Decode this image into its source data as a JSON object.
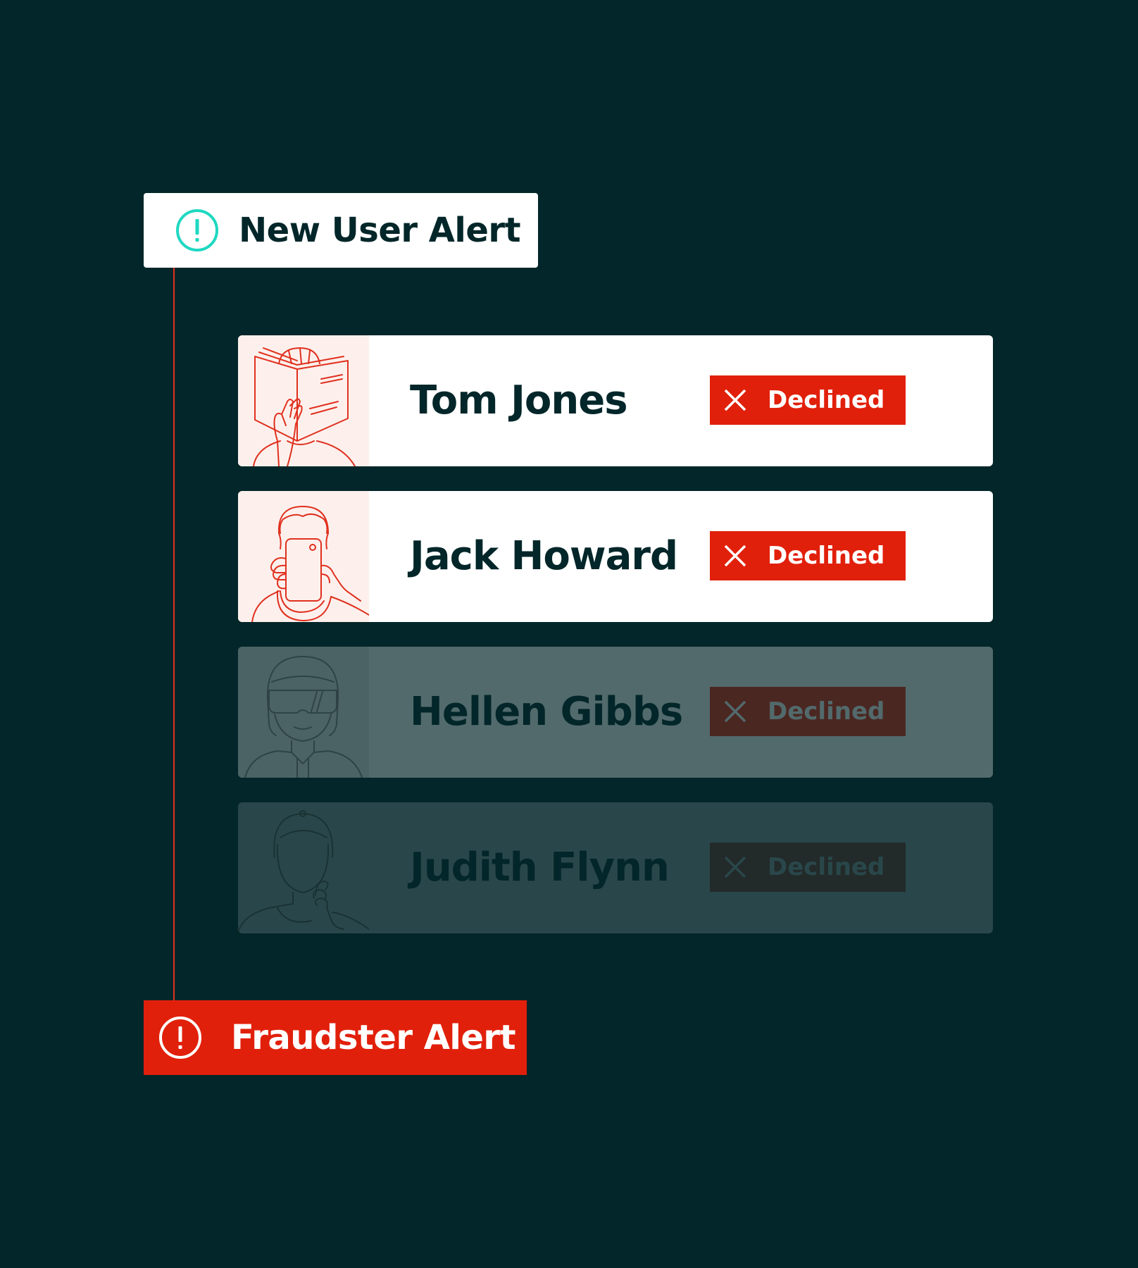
{
  "colors": {
    "background": "#022629",
    "accent_red": "#e1200b",
    "accent_teal": "#1fd8c1",
    "text_dark": "#022629",
    "avatar_bg": "#fdf0ec"
  },
  "new_user_alert": {
    "title": "New User Alert",
    "icon": "info-circle-icon"
  },
  "fraudster_alert": {
    "title": "Fraudster Alert",
    "icon": "alert-circle-icon"
  },
  "users": [
    {
      "name": "Tom Jones",
      "status": "Declined",
      "avatar": "person-reading-book-icon"
    },
    {
      "name": "Jack Howard",
      "status": "Declined",
      "avatar": "person-taking-selfie-icon"
    },
    {
      "name": "Hellen Gibbs",
      "status": "Declined",
      "avatar": "person-with-helmet-visor-icon"
    },
    {
      "name": "Judith Flynn",
      "status": "Declined",
      "avatar": "person-thinking-icon"
    }
  ]
}
